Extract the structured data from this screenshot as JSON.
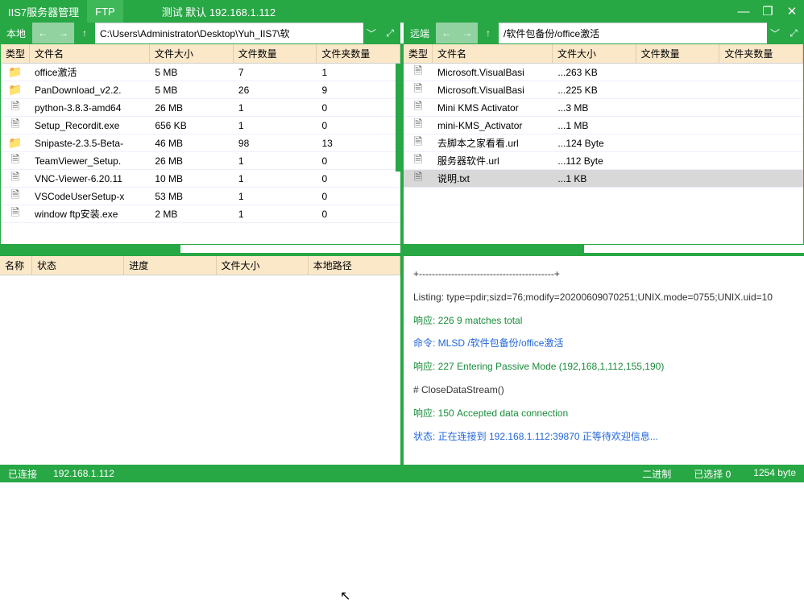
{
  "titlebar": {
    "app_name": "IIS7服务器管理",
    "ftp_tag": "FTP",
    "conn_info": "测试  默认   192.168.1.112",
    "min": "—",
    "max": "❐",
    "close": "✕"
  },
  "nav": {
    "local_label": "本地",
    "remote_label": "远端",
    "arrow_left": "←",
    "arrow_right": "→",
    "arrow_up": "↑",
    "chev_down": "﹀",
    "expand": "⤢",
    "local_path": "C:\\Users\\Administrator\\Desktop\\Yuh_IIS7\\软",
    "remote_path": "/软件包备份/office激活"
  },
  "headers": {
    "type": "类型",
    "name": "文件名",
    "size": "文件大小",
    "count": "文件数量",
    "folders": "文件夹数量"
  },
  "local_rows": [
    {
      "icon": "folder",
      "name": "office激活",
      "size": "5 MB",
      "count": "7",
      "folders": "1"
    },
    {
      "icon": "folder",
      "name": "PanDownload_v2.2.",
      "size": "5 MB",
      "count": "26",
      "folders": "9"
    },
    {
      "icon": "file",
      "name": "python-3.8.3-amd64",
      "size": "26 MB",
      "count": "1",
      "folders": "0"
    },
    {
      "icon": "file",
      "name": "Setup_Recordit.exe",
      "size": "656 KB",
      "count": "1",
      "folders": "0"
    },
    {
      "icon": "folder",
      "name": "Snipaste-2.3.5-Beta-",
      "size": "46 MB",
      "count": "98",
      "folders": "13"
    },
    {
      "icon": "file",
      "name": "TeamViewer_Setup.",
      "size": "26 MB",
      "count": "1",
      "folders": "0"
    },
    {
      "icon": "file",
      "name": "VNC-Viewer-6.20.11",
      "size": "10 MB",
      "count": "1",
      "folders": "0"
    },
    {
      "icon": "file",
      "name": "VSCodeUserSetup-x",
      "size": "53 MB",
      "count": "1",
      "folders": "0"
    },
    {
      "icon": "file",
      "name": "window ftp安装.exe",
      "size": "2 MB",
      "count": "1",
      "folders": "0"
    }
  ],
  "remote_rows": [
    {
      "icon": "file",
      "name": "Microsoft.VisualBasi",
      "size": "...263 KB",
      "count": "",
      "folders": ""
    },
    {
      "icon": "file",
      "name": "Microsoft.VisualBasi",
      "size": "...225 KB",
      "count": "",
      "folders": ""
    },
    {
      "icon": "file",
      "name": "Mini KMS Activator",
      "size": "...3 MB",
      "count": "",
      "folders": ""
    },
    {
      "icon": "file",
      "name": "mini-KMS_Activator",
      "size": "...1 MB",
      "count": "",
      "folders": ""
    },
    {
      "icon": "file",
      "name": "去脚本之家看看.url",
      "size": "...124 Byte",
      "count": "",
      "folders": ""
    },
    {
      "icon": "file",
      "name": "服务器软件.url",
      "size": "...112 Byte",
      "count": "",
      "folders": ""
    },
    {
      "icon": "file",
      "name": "说明.txt",
      "size": "...1 KB",
      "count": "",
      "folders": "",
      "selected": true
    }
  ],
  "transfer_headers": {
    "name": "名称",
    "status": "状态",
    "progress": "进度",
    "size": "文件大小",
    "localpath": "本地路径"
  },
  "log": [
    {
      "cls": "log-dash",
      "text": "+------------------------------------------+"
    },
    {
      "cls": "log-list",
      "text": "Listing:  type=pdir;sizd=76;modify=20200609070251;UNIX.mode=0755;UNIX.uid=10"
    },
    {
      "cls": "log-resp",
      "text": "响应: 226 9 matches total"
    },
    {
      "cls": "log-cmd",
      "text": "命令:  MLSD /软件包备份/office激活"
    },
    {
      "cls": "log-resp",
      "text": "响应: 227 Entering Passive Mode (192,168,1,112,155,190)"
    },
    {
      "cls": "log-close",
      "text": "# CloseDataStream()"
    },
    {
      "cls": "log-resp",
      "text": "响应: 150 Accepted data connection"
    },
    {
      "cls": "log-status",
      "text": "状态:  正在连接到  192.168.1.112:39870  正等待欢迎信息..."
    }
  ],
  "status": {
    "connected": "已连接",
    "ip": "192.168.1.112",
    "mode": "二进制",
    "selected": "已选择 0",
    "bytes": "1254 byte"
  }
}
